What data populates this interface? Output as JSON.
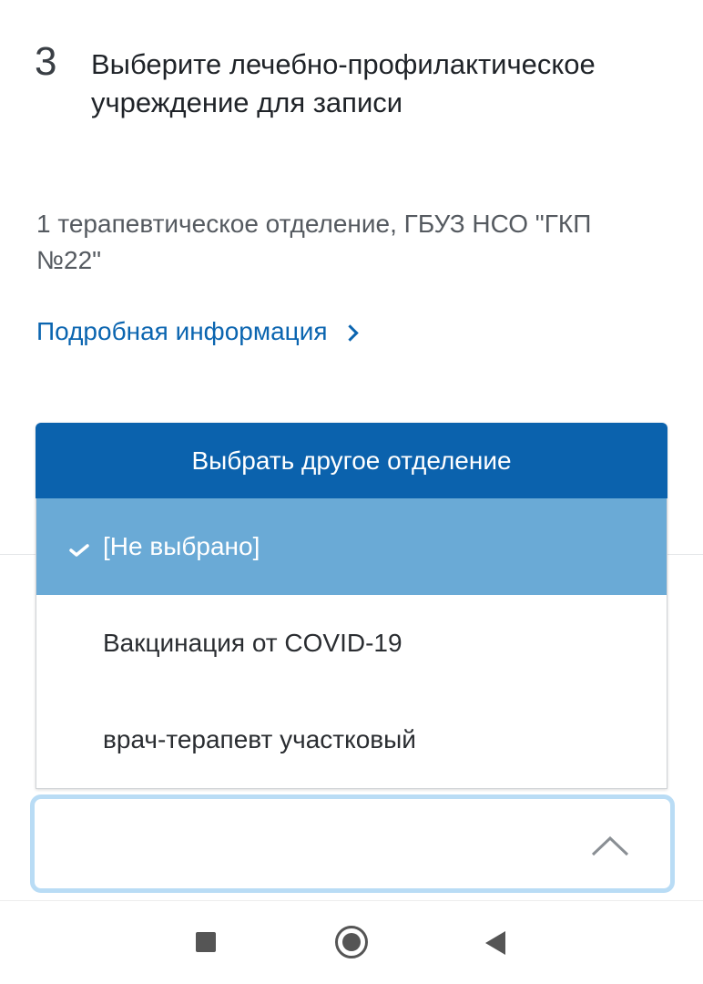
{
  "step": {
    "number": "3",
    "title": "Выберите лечебно-профилактическое учреждение для записи"
  },
  "facility": {
    "name": "1 терапевтическое отделение, ГБУЗ НСО \"ГКП №22\"",
    "details_link": "Подробная информация"
  },
  "dropdown": {
    "header": "Выбрать другое отделение",
    "options": [
      {
        "label": "[Не выбрано]",
        "selected": true
      },
      {
        "label": "Вакцинация от COVID-19",
        "selected": false
      },
      {
        "label": "врач-терапевт участковый",
        "selected": false
      }
    ]
  },
  "colors": {
    "header_bg": "#0b62ad",
    "selected_bg": "#6aaad6",
    "link": "#0b65b0",
    "focus_border": "#b9dcf5"
  },
  "icons": {
    "details_link": "chevron-right-icon",
    "selected_option": "check-icon",
    "select_box": "chevron-up-icon",
    "nav": [
      "recent-apps-icon",
      "home-icon",
      "back-icon"
    ]
  }
}
